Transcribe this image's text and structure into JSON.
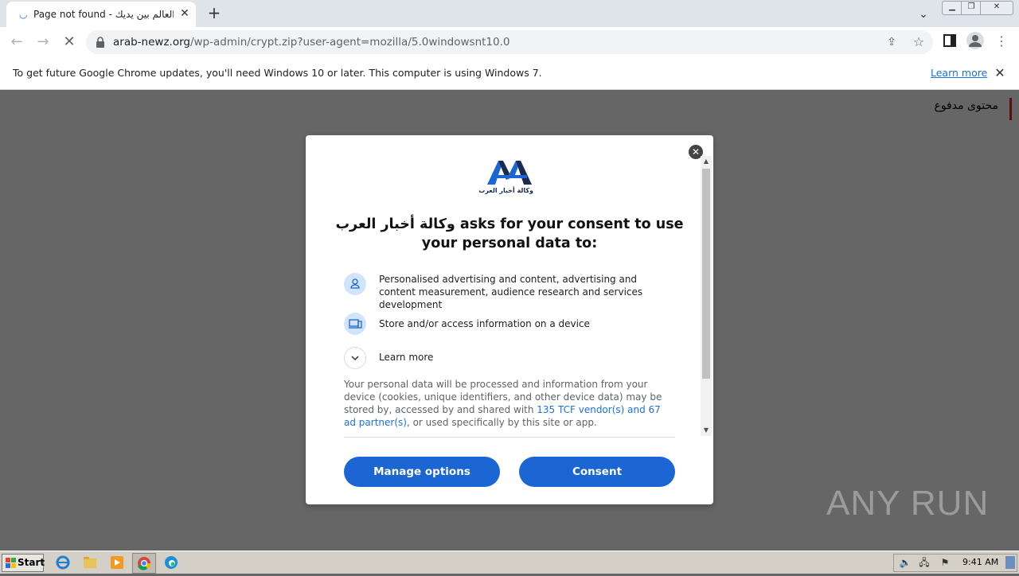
{
  "browser": {
    "tab": {
      "title": "Page not found - وكالة أخبار العرب : العالم بين يديك"
    },
    "url": {
      "host": "arab-newz.org",
      "path": "/wp-admin/crypt.zip?user-agent=mozilla/5.0windowsnt10.0"
    },
    "infobar": {
      "message": "To get future Google Chrome updates, you'll need Windows 10 or later. This computer is using Windows 7.",
      "link": "Learn more"
    }
  },
  "page": {
    "paid_content": "محتوى مدفوع"
  },
  "dialog": {
    "logo": {
      "caption": "وكالة أخبار العرب"
    },
    "heading": "وكالة أخبار العرب asks for your consent to use your personal data to:",
    "purposes": [
      {
        "icon": "person-icon",
        "text": "Personalised advertising and content, advertising and content measurement, audience research and services development"
      },
      {
        "icon": "device-icon",
        "text": "Store and/or access information on a device"
      }
    ],
    "learn_more": "Learn more",
    "body": {
      "before": "Your personal data will be processed and information from your device (cookies, unique identifiers, and other device data) may be stored by, accessed by and shared with ",
      "link": "135 TCF vendor(s) and 67 ad partner(s)",
      "after": ", or used specifically by this site or app."
    },
    "buttons": {
      "manage": "Manage options",
      "consent": "Consent"
    },
    "brand_color": "#1b66d2"
  },
  "watermark": "ANY RUN",
  "taskbar": {
    "start": "Start",
    "clock": "9:41 AM"
  }
}
